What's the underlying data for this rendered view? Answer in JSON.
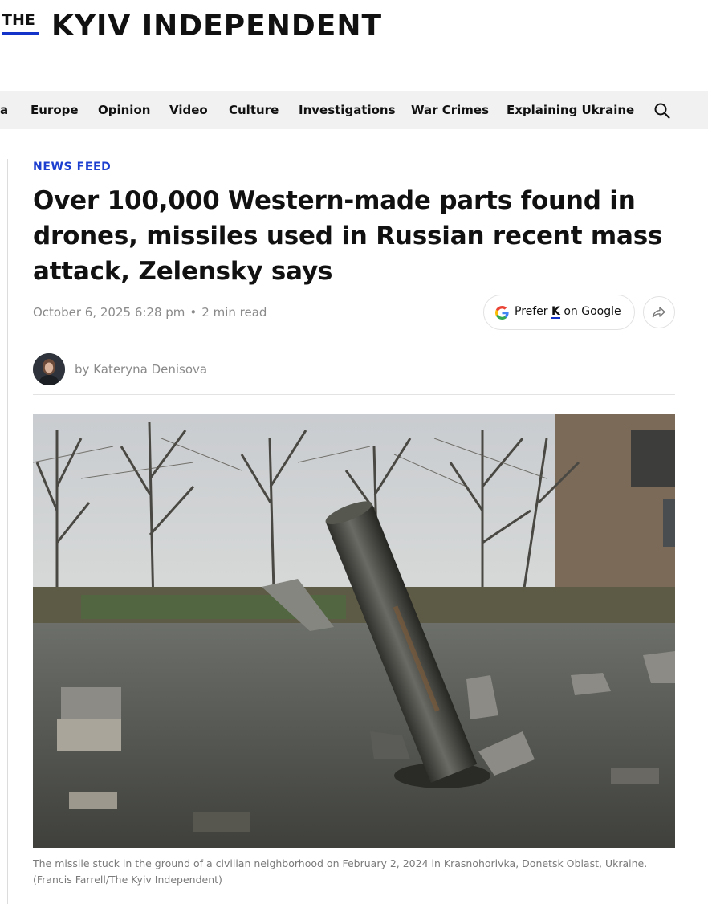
{
  "logo": {
    "prefix": "THE",
    "name": "KYIV INDEPENDENT"
  },
  "nav": {
    "items": [
      "a",
      "Europe",
      "Opinion",
      "Video",
      "Culture",
      "Investigations",
      "War Crimes",
      "Explaining Ukraine"
    ],
    "search_icon": "search-icon"
  },
  "article": {
    "kicker": "NEWS FEED",
    "headline": "Over 100,000 Western-made parts found in drones, missiles used in Russian recent mass attack, Zelensky says",
    "date": "October 6, 2025 6:28 pm",
    "separator": "•",
    "read_time": "2 min read",
    "prefer_button": {
      "prefix": "Prefer",
      "brand_letter": "K",
      "suffix": "on Google"
    },
    "share_icon": "share-arrow-icon",
    "byline_prefix": "by",
    "author": "Kateryna Denisova",
    "caption": "The missile stuck in the ground of a civilian neighborhood on February 2, 2024 in Krasnohorivka, Donetsk Oblast, Ukraine. (Francis Farrell/The Kyiv Independent)"
  },
  "colors": {
    "accent": "#1d3fd0",
    "logo_bar": "#1433c8",
    "nav_bg": "#f1f1f1",
    "meta": "#8a8a8a"
  }
}
